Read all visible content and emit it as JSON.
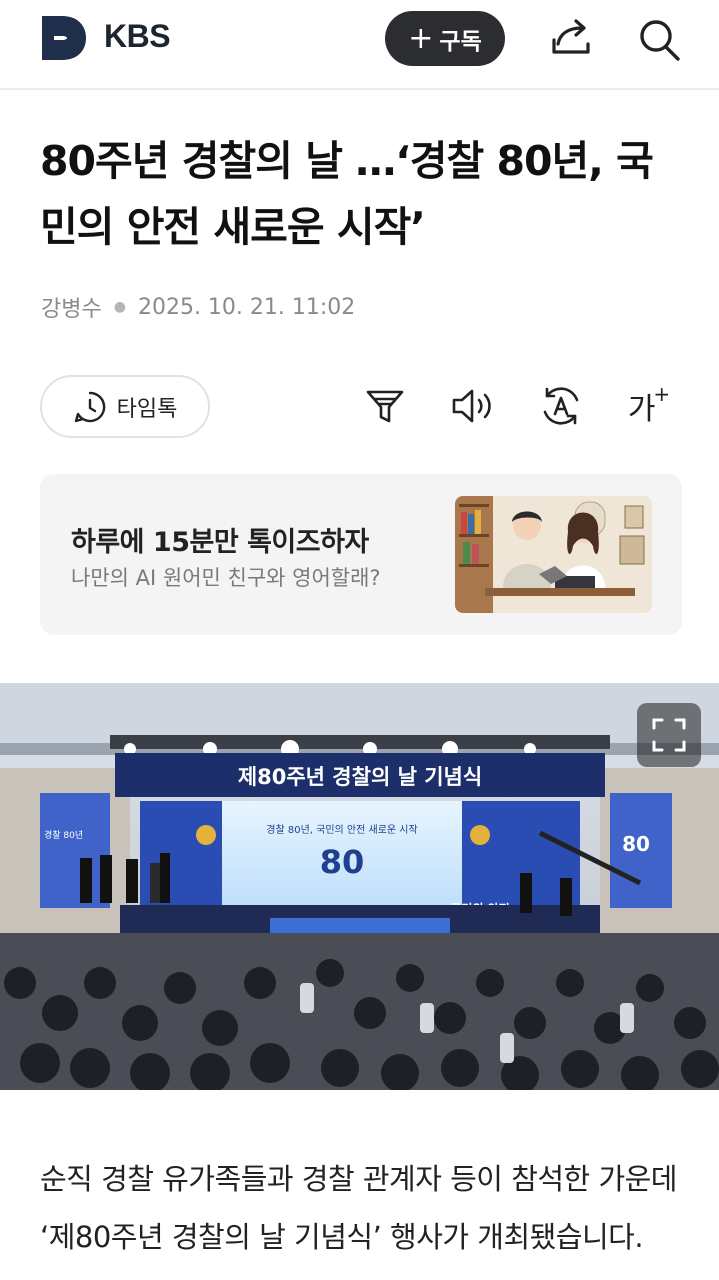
{
  "header": {
    "brand": "KBS",
    "subscribe_label": "구독",
    "subscribe_icon": "plus-icon",
    "share_icon": "share-icon",
    "search_icon": "search-icon"
  },
  "article": {
    "title": "80주년 경찰의 날 …‘경찰 80년, 국민의 안전 새로운 시작’",
    "author": "강병수",
    "date": "2025. 10. 21. 11:02",
    "body": "순직 경찰 유가족들과 경찰 관계자 등이 참석한 가운데 ‘제80주년 경찰의 날 기념식’ 행사가 개최됐습니다."
  },
  "toolbar": {
    "timetalk_label": "타임톡",
    "font_label": "가",
    "icons": [
      "timetalk-icon",
      "summary-filter-icon",
      "speaker-icon",
      "translate-icon",
      "font-size-icon"
    ]
  },
  "promo": {
    "title": "하루에 15분만 톡이즈하자",
    "subtitle": "나만의 AI 원어민 친구와 영어할래?"
  },
  "photo": {
    "banner_text": "제80주년 경찰의 날 기념식",
    "screen_text": "경찰 80년, 국민의 안전 새로운 시작",
    "side_text_left": "경찰 80년",
    "side_text_right": "국민의 안전",
    "logo_text": "80"
  },
  "colors": {
    "subscribe_bg": "#2b2d31",
    "logo_navy": "#1f2e4a",
    "stage_blue": "#2a4db3"
  }
}
